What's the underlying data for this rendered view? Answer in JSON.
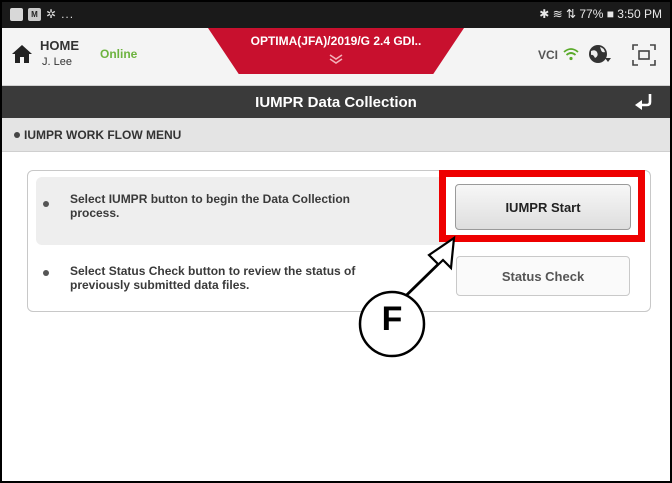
{
  "status_bar": {
    "left_text": "...",
    "right_text": "✱ ≋ ⇅ 77% ■ 3:50 PM"
  },
  "header": {
    "home_label": "HOME",
    "user": "J. Lee",
    "connection_status": "Online",
    "vehicle": "OPTIMA(JFA)/2019/G 2.4 GDI..",
    "vci_label": "VCI"
  },
  "title_bar": {
    "title": "IUMPR Data Collection"
  },
  "subheader": {
    "label": "IUMPR WORK FLOW MENU"
  },
  "rows": [
    {
      "text_lines": [
        "Select IUMPR button to begin the Data Collection",
        "process."
      ],
      "button_label": "IUMPR Start"
    },
    {
      "text_lines": [
        "Select Status Check button to review the status of",
        "previously submitted data files."
      ],
      "button_label": "Status Check"
    }
  ],
  "annotation": {
    "callout_letter": "F",
    "highlight_color": "#ee0000"
  },
  "colors": {
    "brand_red": "#c8102e",
    "online_green": "#6db33f",
    "title_bar_bg": "#3a3a3a"
  },
  "icons": {
    "home": "home-icon",
    "wifi": "wifi-icon",
    "globe": "globe-icon",
    "expand": "expand-icon",
    "back": "back-arrow-icon"
  }
}
